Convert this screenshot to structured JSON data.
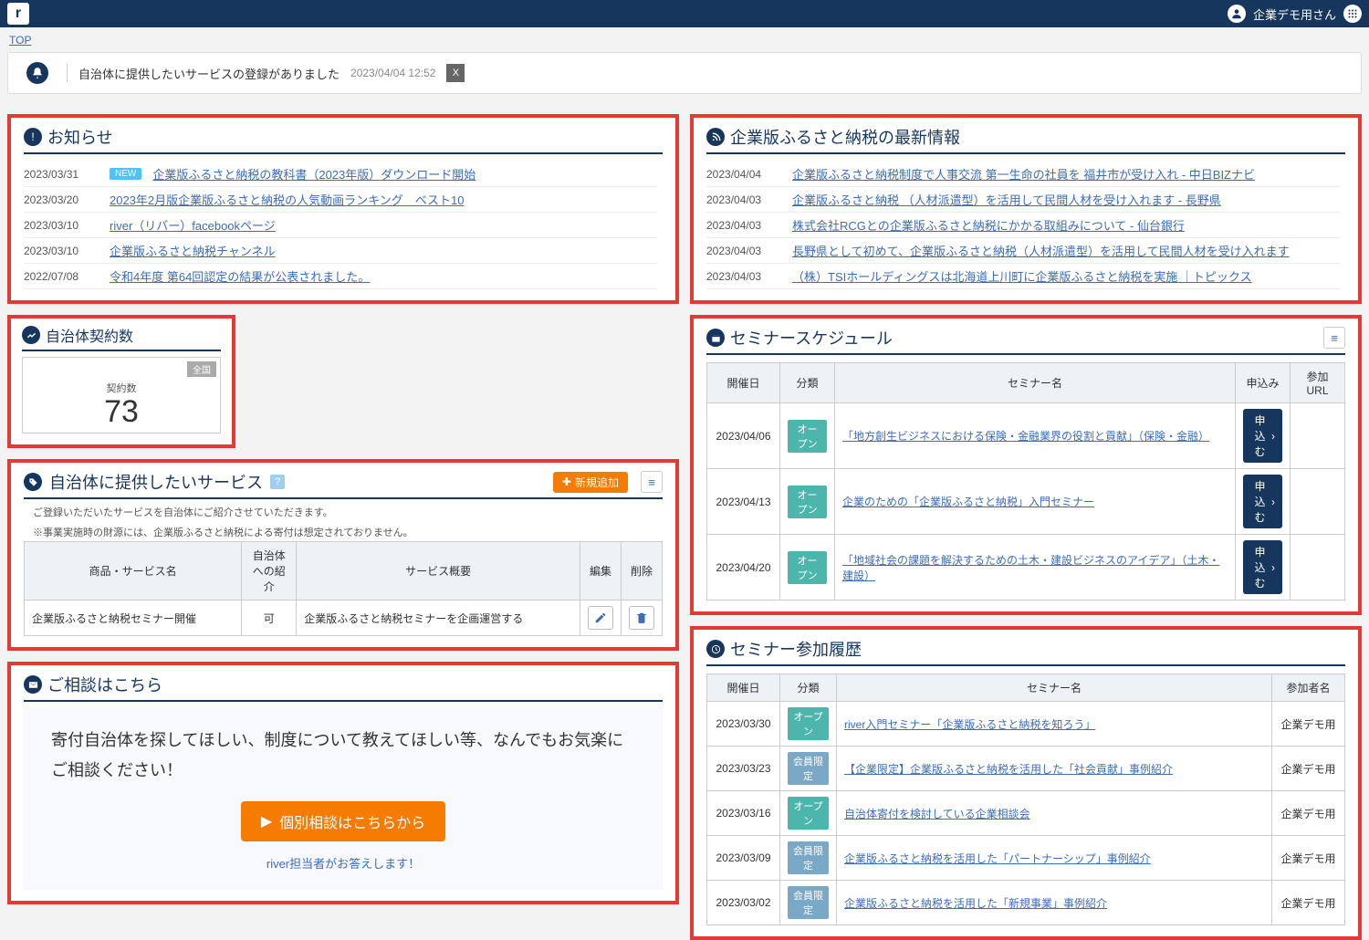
{
  "header": {
    "user_label": "企業デモ用さん"
  },
  "breadcrumb": {
    "top": "TOP"
  },
  "notification": {
    "text": "自治体に提供したいサービスの登録がありました",
    "timestamp": "2023/04/04 12:52",
    "close": "X"
  },
  "news": {
    "title": "お知らせ",
    "new_label": "NEW",
    "items": [
      {
        "date": "2023/03/31",
        "text": "企業版ふるさと納税の教科書（2023年版）ダウンロード開始",
        "is_new": true
      },
      {
        "date": "2023/03/20",
        "text": "2023年2月版企業版ふるさと納税の人気動画ランキング　ベスト10",
        "is_new": false
      },
      {
        "date": "2023/03/10",
        "text": "river（リバー）facebookページ",
        "is_new": false
      },
      {
        "date": "2023/03/10",
        "text": "企業版ふるさと納税チャンネル",
        "is_new": false
      },
      {
        "date": "2022/07/08",
        "text": "令和4年度 第64回認定の結果が公表されました。",
        "is_new": false
      }
    ]
  },
  "latest": {
    "title": "企業版ふるさと納税の最新情報",
    "items": [
      {
        "date": "2023/04/04",
        "text": "企業版ふるさと納税制度で人事交流 第一生命の社員を 福井市が受け入れ - 中日BIZナビ"
      },
      {
        "date": "2023/04/03",
        "text": "企業版ふるさと納税 （人材派遣型）を活用して民間人材を受け入れます - 長野県"
      },
      {
        "date": "2023/04/03",
        "text": "株式会社RCGとの企業版ふるさと納税にかかる取組みについて - 仙台銀行"
      },
      {
        "date": "2023/04/03",
        "text": "長野県として初めて、企業版ふるさと納税（人材派遣型）を活用して民間人材を受け入れます"
      },
      {
        "date": "2023/04/03",
        "text": "（株）TSIホールディングスは北海道上川町に企業版ふるさと納税を実施 ｜トピックス"
      }
    ]
  },
  "contracts": {
    "title": "自治体契約数",
    "region_label": "全国",
    "sub_label": "契約数",
    "count": "73"
  },
  "services": {
    "title": "自治体に提供したいサービス",
    "add_label": "新規追加",
    "note1": "ご登録いただいたサービスを自治体にご紹介させていただきます。",
    "note2": "※事業実施時の財源には、企業版ふるさと納税による寄付は想定されておりません。",
    "cols": {
      "name": "商品・サービス名",
      "intro": "自治体への紹介",
      "summary": "サービス概要",
      "edit": "編集",
      "del": "削除"
    },
    "rows": [
      {
        "name": "企業版ふるさと納税セミナー開催",
        "intro": "可",
        "summary": "企業版ふるさと納税セミナーを企画運営する"
      }
    ]
  },
  "consult": {
    "title": "ご相談はこちら",
    "message": "寄付自治体を探してほしい、制度について教えてほしい等、なんでもお気楽にご相談ください！",
    "button": "個別相談はこちらから",
    "footer": "river担当者がお答えします！"
  },
  "schedule": {
    "title": "セミナースケジュール",
    "cols": {
      "date": "開催日",
      "type": "分類",
      "name": "セミナー名",
      "apply": "申込み",
      "url": "参加URL"
    },
    "open_label": "オープン",
    "apply_label": "申込む",
    "rows": [
      {
        "date": "2023/04/06",
        "name": "「地方創生ビジネスにおける保険・金融業界の役割と貢献」（保険・金融）"
      },
      {
        "date": "2023/04/13",
        "name": "企業のための「企業版ふるさと納税」入門セミナー"
      },
      {
        "date": "2023/04/20",
        "name": "「地域社会の課題を解決するための土木・建設ビジネスのアイデア」（土木・建設）"
      }
    ]
  },
  "history": {
    "title": "セミナー参加履歴",
    "cols": {
      "date": "開催日",
      "type": "分類",
      "name": "セミナー名",
      "attendee": "参加者名"
    },
    "open_label": "オープン",
    "member_label": "会員限定",
    "attendee": "企業デモ用",
    "rows": [
      {
        "date": "2023/03/30",
        "type": "open",
        "name": "river入門セミナー「企業版ふるさと納税を知ろう」"
      },
      {
        "date": "2023/03/23",
        "type": "member",
        "name": "【企業限定】企業版ふるさと納税を活用した「社会貢献」事例紹介"
      },
      {
        "date": "2023/03/16",
        "type": "open",
        "name": "自治体寄付を検討している企業相談会"
      },
      {
        "date": "2023/03/09",
        "type": "member",
        "name": "企業版ふるさと納税を活用した「パートナーシップ」事例紹介"
      },
      {
        "date": "2023/03/02",
        "type": "member",
        "name": "企業版ふるさと納税を活用した「新規事業」事例紹介"
      }
    ]
  }
}
